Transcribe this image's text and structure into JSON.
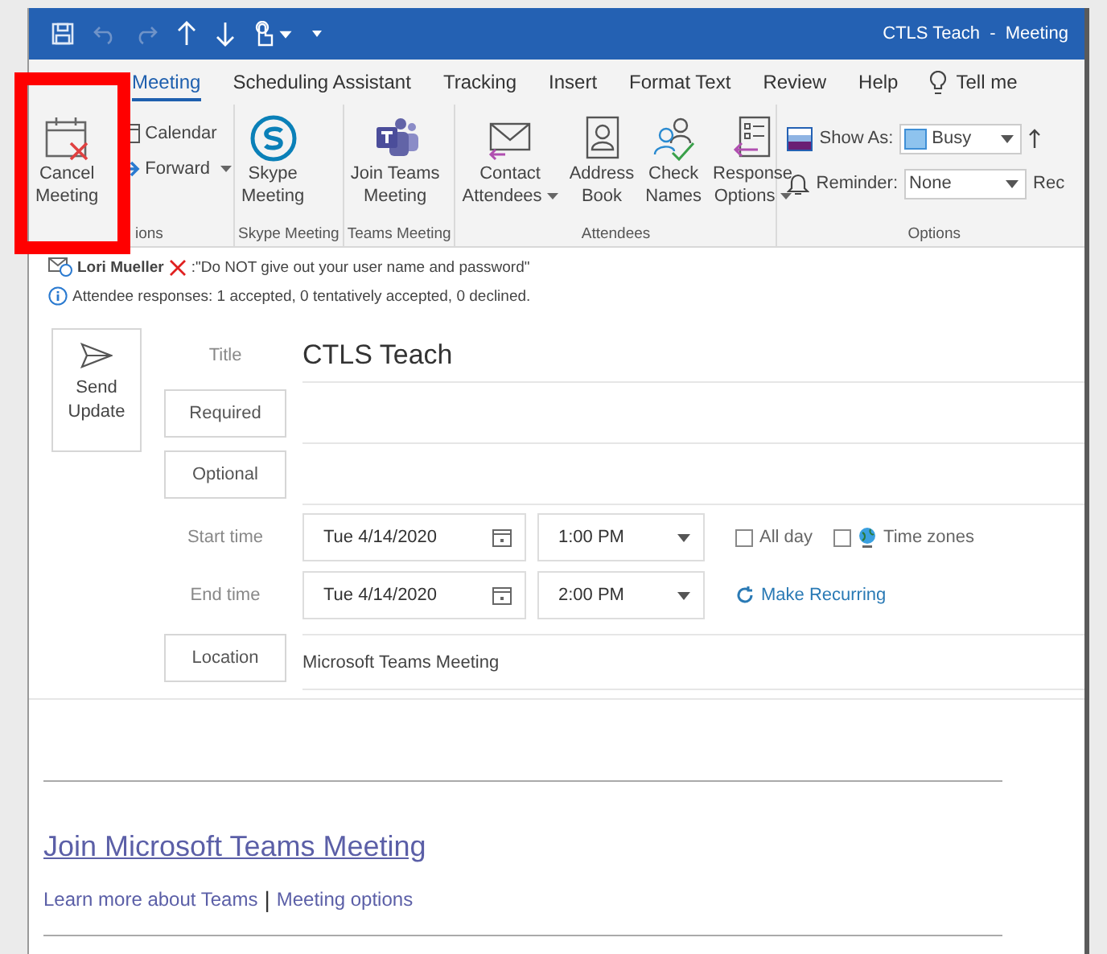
{
  "window": {
    "title": "CTLS Teach  -  Meeting"
  },
  "tabs": [
    {
      "label": "Meeting",
      "selected": true
    },
    {
      "label": "Scheduling Assistant",
      "selected": false
    },
    {
      "label": "Tracking",
      "selected": false
    },
    {
      "label": "Insert",
      "selected": false
    },
    {
      "label": "Format Text",
      "selected": false
    },
    {
      "label": "Review",
      "selected": false
    },
    {
      "label": "Help",
      "selected": false
    }
  ],
  "tell_me": "Tell me",
  "ribbon_groups": [
    {
      "label": "ions",
      "buttons": [
        {
          "kind": "large",
          "lines": [
            "Cancel",
            "Meeting"
          ],
          "has_menu": false
        },
        {
          "kind": "small",
          "label": "Calendar",
          "has_menu": false
        },
        {
          "kind": "small",
          "label": "Forward",
          "has_menu": true
        }
      ]
    },
    {
      "label": "Skype Meeting",
      "buttons": [
        {
          "kind": "large",
          "lines": [
            "Skype",
            "Meeting"
          ],
          "has_menu": false
        }
      ]
    },
    {
      "label": "Teams Meeting",
      "buttons": [
        {
          "kind": "large",
          "lines": [
            "Join Teams",
            "Meeting"
          ],
          "has_menu": false
        }
      ]
    },
    {
      "label": "Attendees",
      "buttons": [
        {
          "kind": "large",
          "lines": [
            "Contact",
            "Attendees"
          ],
          "has_menu": true
        },
        {
          "kind": "large",
          "lines": [
            "Address",
            "Book"
          ],
          "has_menu": false
        },
        {
          "kind": "large",
          "lines": [
            "Check",
            "Names"
          ],
          "has_menu": false
        },
        {
          "kind": "large",
          "lines": [
            "Response",
            "Options"
          ],
          "has_menu": true
        }
      ]
    }
  ],
  "options_group": {
    "label": "Options",
    "show_as": {
      "label": "Show As:",
      "value": "Busy"
    },
    "reminder": {
      "label": "Reminder:",
      "value": "None"
    },
    "cut_text": "Rec"
  },
  "notices": [
    {
      "kind": "sender",
      "name": "Lori Mueller",
      "text": ":\"Do NOT give out your user name and password\""
    },
    {
      "kind": "info",
      "text": "Attendee responses: 1 accepted, 0 tentatively accepted, 0 declined."
    }
  ],
  "send_button": {
    "lines": [
      "Send",
      "Update"
    ]
  },
  "form": {
    "title": {
      "label": "Title",
      "value": "CTLS Teach"
    },
    "required": {
      "label": "Required"
    },
    "optional": {
      "label": "Optional"
    },
    "start": {
      "label": "Start time",
      "date": "Tue 4/14/2020",
      "time": "1:00 PM"
    },
    "all_day": {
      "label": "All day",
      "checked": false
    },
    "time_zones": {
      "label": "Time zones",
      "checked": false
    },
    "end": {
      "label": "End time",
      "date": "Tue 4/14/2020",
      "time": "2:00 PM"
    },
    "make_recurring": "Make Recurring",
    "location": {
      "label": "Location",
      "value": "Microsoft Teams Meeting"
    }
  },
  "body": {
    "join_link": "Join Microsoft Teams Meeting",
    "learn_more": "Learn more about Teams",
    "separator": "|",
    "meeting_options": "Meeting options"
  }
}
